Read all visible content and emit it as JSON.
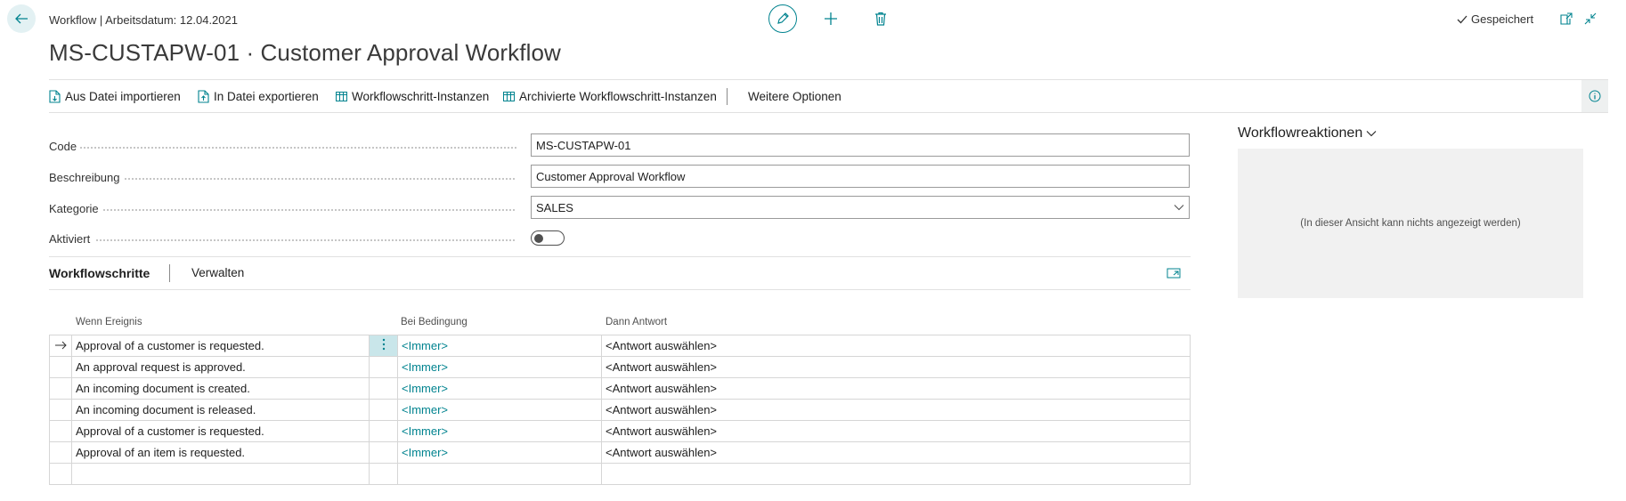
{
  "header": {
    "breadcrumb": "Workflow | Arbeitsdatum: 12.04.2021",
    "title": "MS-CUSTAPW-01 · Customer Approval Workflow",
    "status": "Gespeichert"
  },
  "actions": [
    {
      "label": "Aus Datei importieren",
      "icon": "file-import-icon"
    },
    {
      "label": "In Datei exportieren",
      "icon": "file-export-icon"
    },
    {
      "label": "Workflowschritt-Instanzen",
      "icon": "table-icon"
    },
    {
      "label": "Archivierte Workflowschritt-Instanzen",
      "icon": "table-icon"
    },
    {
      "label": "Weitere Optionen"
    }
  ],
  "fields": {
    "code": {
      "label": "Code",
      "value": "MS-CUSTAPW-01"
    },
    "description": {
      "label": "Beschreibung",
      "value": "Customer Approval Workflow"
    },
    "category": {
      "label": "Kategorie",
      "value": "SALES"
    },
    "enabled": {
      "label": "Aktiviert",
      "value": false
    }
  },
  "steps": {
    "title": "Workflowschritte",
    "manage": "Verwalten",
    "columns": {
      "event": "Wenn Ereignis",
      "condition": "Bei Bedingung",
      "response": "Dann Antwort"
    },
    "rows": [
      {
        "event": "Approval of a customer is requested.",
        "condition": "<Immer>",
        "response": "<Antwort auswählen>",
        "selected": true
      },
      {
        "event": "An approval request is approved.",
        "condition": "<Immer>",
        "response": "<Antwort auswählen>"
      },
      {
        "event": "An incoming document is created.",
        "condition": "<Immer>",
        "response": "<Antwort auswählen>"
      },
      {
        "event": "An incoming document is released.",
        "condition": "<Immer>",
        "response": "<Antwort auswählen>"
      },
      {
        "event": "Approval of a customer is requested.",
        "condition": "<Immer>",
        "response": "<Antwort auswählen>"
      },
      {
        "event": "Approval of an item is requested.",
        "condition": "<Immer>",
        "response": "<Antwort auswählen>"
      },
      {
        "event": "",
        "condition": "",
        "response": ""
      }
    ]
  },
  "factbox": {
    "title": "Workflowreaktionen",
    "empty_message": "(In dieser Ansicht kann nichts angezeigt werden)"
  },
  "colors": {
    "accent": "#00838f",
    "panel_bg": "#f1f1f1",
    "selected_cell": "#c9e6ea"
  }
}
